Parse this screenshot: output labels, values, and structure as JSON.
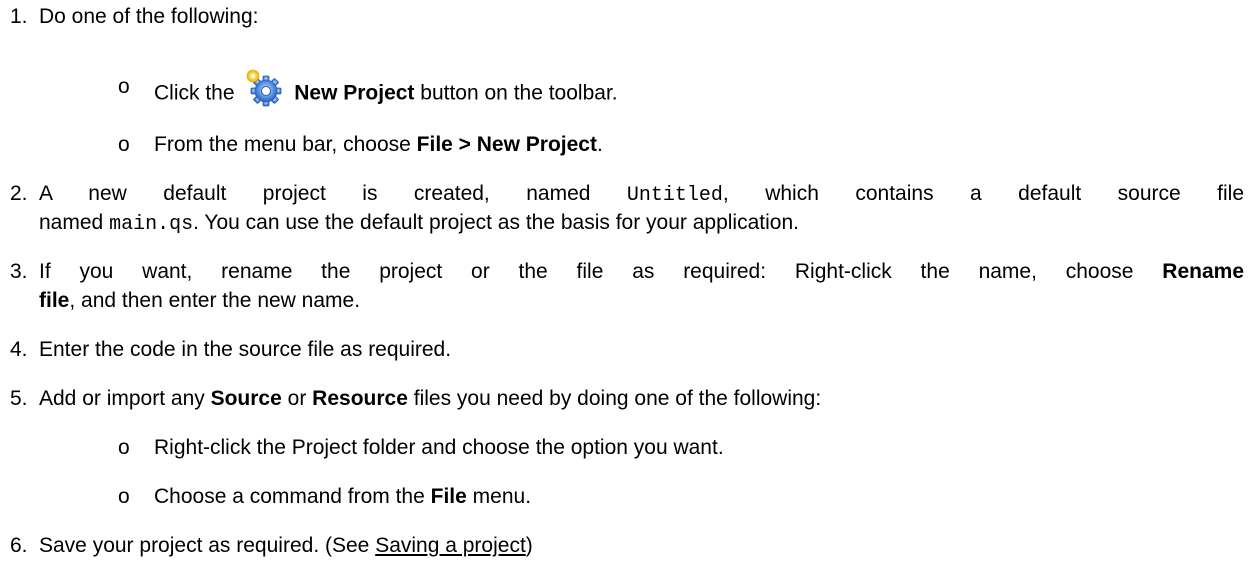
{
  "steps": [
    {
      "num": "1.",
      "text": "Do one of the following:",
      "subs": [
        {
          "bullet": "o",
          "prefix": "Click the",
          "icon": "new-project-gear-icon",
          "bold": "New Project",
          "suffix": "button on the toolbar."
        },
        {
          "bullet": "o",
          "prefix": "From the menu bar, choose",
          "bold": "File > New Project",
          "suffix": "."
        }
      ]
    },
    {
      "num": "2.",
      "line1": {
        "a": "A new default project is created, named",
        "code1": "Untitled",
        "b": ", which contains a default source file"
      },
      "line2": {
        "a": "named",
        "code2": "main.qs",
        "b": ". You can use the default project as the basis for your application."
      }
    },
    {
      "num": "3.",
      "line1": {
        "a": "If you want, rename the project or the file as required: Right-click the name, choose",
        "bold": "Rename"
      },
      "line2": {
        "bold": "file",
        "b": ", and then enter the new name."
      }
    },
    {
      "num": "4.",
      "text": "Enter the code in the source file as required."
    },
    {
      "num": "5.",
      "a": "Add or import any",
      "bold1": "Source",
      "mid": "or",
      "bold2": "Resource",
      "b": "files you need by doing one of the following:",
      "subs": [
        {
          "bullet": "o",
          "text": "Right-click the Project folder and choose the option you want."
        },
        {
          "bullet": "o",
          "prefix": "Choose a command from the",
          "bold": "File",
          "suffix": "menu."
        }
      ]
    },
    {
      "num": "6.",
      "a": "Save your project as required. (See",
      "link": "Saving a project",
      "b": ")"
    }
  ],
  "colors": {
    "text": "#000000",
    "background": "#ffffff",
    "icon_primary": "#3a7bd5",
    "icon_highlight": "#f5c518"
  }
}
